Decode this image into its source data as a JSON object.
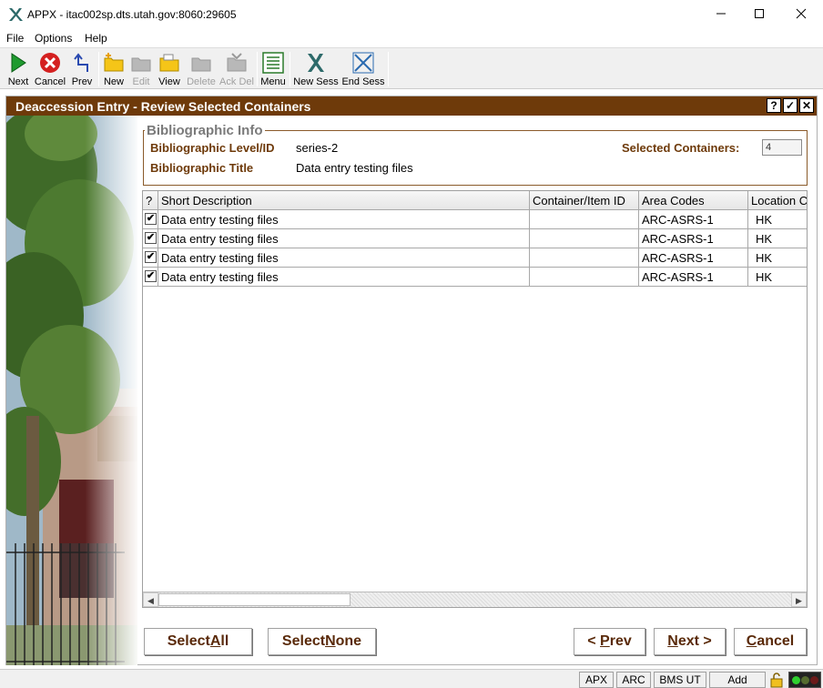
{
  "window": {
    "title": "APPX - itac002sp.dts.utah.gov:8060:29605"
  },
  "menu": [
    "File",
    "Options",
    "Help"
  ],
  "toolbar": {
    "next": "Next",
    "cancel": "Cancel",
    "prev": "Prev",
    "new": "New",
    "edit": "Edit",
    "view": "View",
    "delete": "Delete",
    "ack_del": "Ack Del",
    "menu": "Menu",
    "new_sess": "New Sess",
    "end_sess": "End Sess"
  },
  "header": {
    "title": "Deaccession Entry - Review Selected Containers",
    "help": "?",
    "ok": "✓",
    "close": "✕"
  },
  "biblio": {
    "legend": "Bibliographic Info",
    "level_label": "Bibliographic Level/ID",
    "level_value": "series-2",
    "title_label": "Bibliographic Title",
    "title_value": "Data entry testing files",
    "selected_label": "Selected Containers:",
    "selected_value": "4"
  },
  "grid": {
    "columns": [
      "?",
      "Short Description",
      "Container/Item ID",
      "Area Codes",
      "Location C"
    ],
    "rows": [
      {
        "checked": "✔",
        "desc": "Data entry testing files",
        "container": "",
        "area": "ARC-ASRS-1",
        "location": "HK"
      },
      {
        "checked": "✔",
        "desc": "Data entry testing files",
        "container": "",
        "area": "ARC-ASRS-1",
        "location": "HK"
      },
      {
        "checked": "✔",
        "desc": "Data entry testing files",
        "container": "",
        "area": "ARC-ASRS-1",
        "location": "HK"
      },
      {
        "checked": "✔",
        "desc": "Data entry testing files",
        "container": "",
        "area": "ARC-ASRS-1",
        "location": "HK"
      }
    ]
  },
  "buttons": {
    "select_all_pre": "Select ",
    "select_all_u": "A",
    "select_all_post": "ll",
    "select_none_pre": "Select ",
    "select_none_u": "N",
    "select_none_post": "one",
    "prev_pre": "< ",
    "prev_u": "P",
    "prev_post": "rev",
    "next_u": "N",
    "next_post": "ext >",
    "cancel_u": "C",
    "cancel_post": "ancel"
  },
  "status": [
    "APX",
    "ARC",
    "BMS UT",
    "Add"
  ],
  "colors": {
    "header": "#6e3a0a",
    "label": "#6e3a0a",
    "button_text": "#5a2a0a"
  }
}
